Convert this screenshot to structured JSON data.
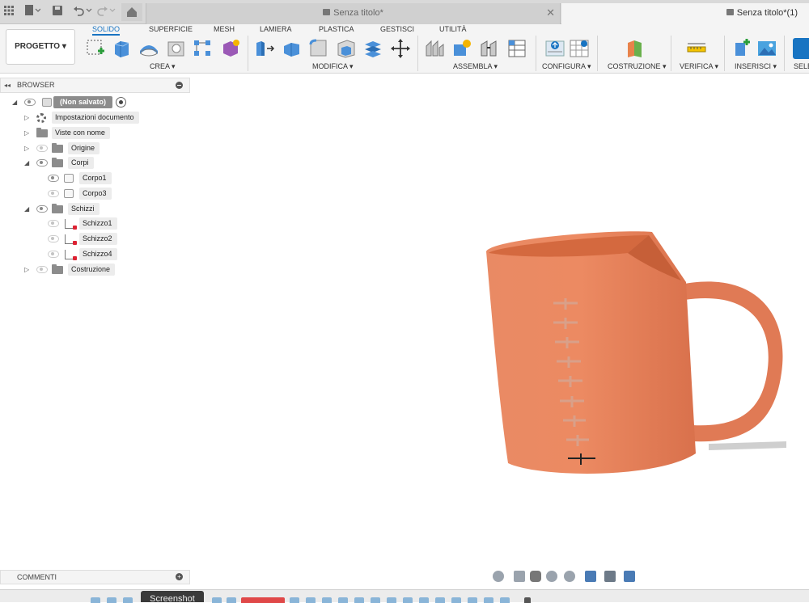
{
  "titlebar": {
    "tabs": [
      {
        "label": "Senza titolo*"
      },
      {
        "label": "Senza titolo*(1)"
      }
    ]
  },
  "toolbar": {
    "project_label": "PROGETTO",
    "tabs": [
      "SOLIDO",
      "SUPERFICIE",
      "MESH",
      "LAMIERA",
      "PLASTICA",
      "GESTISCI",
      "UTILITÀ"
    ],
    "active_tab": "SOLIDO",
    "groups": [
      "CREA",
      "MODIFICA",
      "ASSEMBLA",
      "CONFIGURA",
      "COSTRUZIONE",
      "VERIFICA",
      "INSERISCI",
      "SELE"
    ]
  },
  "browser": {
    "title": "BROWSER",
    "items": [
      {
        "label": "(Non salvato)"
      },
      {
        "label": "Impostazioni documento"
      },
      {
        "label": "Viste con nome"
      },
      {
        "label": "Origine"
      },
      {
        "label": "Corpi"
      },
      {
        "label": "Corpo1"
      },
      {
        "label": "Corpo3"
      },
      {
        "label": "Schizzi"
      },
      {
        "label": "Schizzo1"
      },
      {
        "label": "Schizzo2"
      },
      {
        "label": "Schizzo4"
      },
      {
        "label": "Costruzione"
      }
    ]
  },
  "comments": {
    "label": "COMMENTI"
  },
  "timeline": {
    "tooltip": "Screenshot"
  },
  "colors": {
    "mug": "#e8825e",
    "accent": "#1874c2"
  }
}
